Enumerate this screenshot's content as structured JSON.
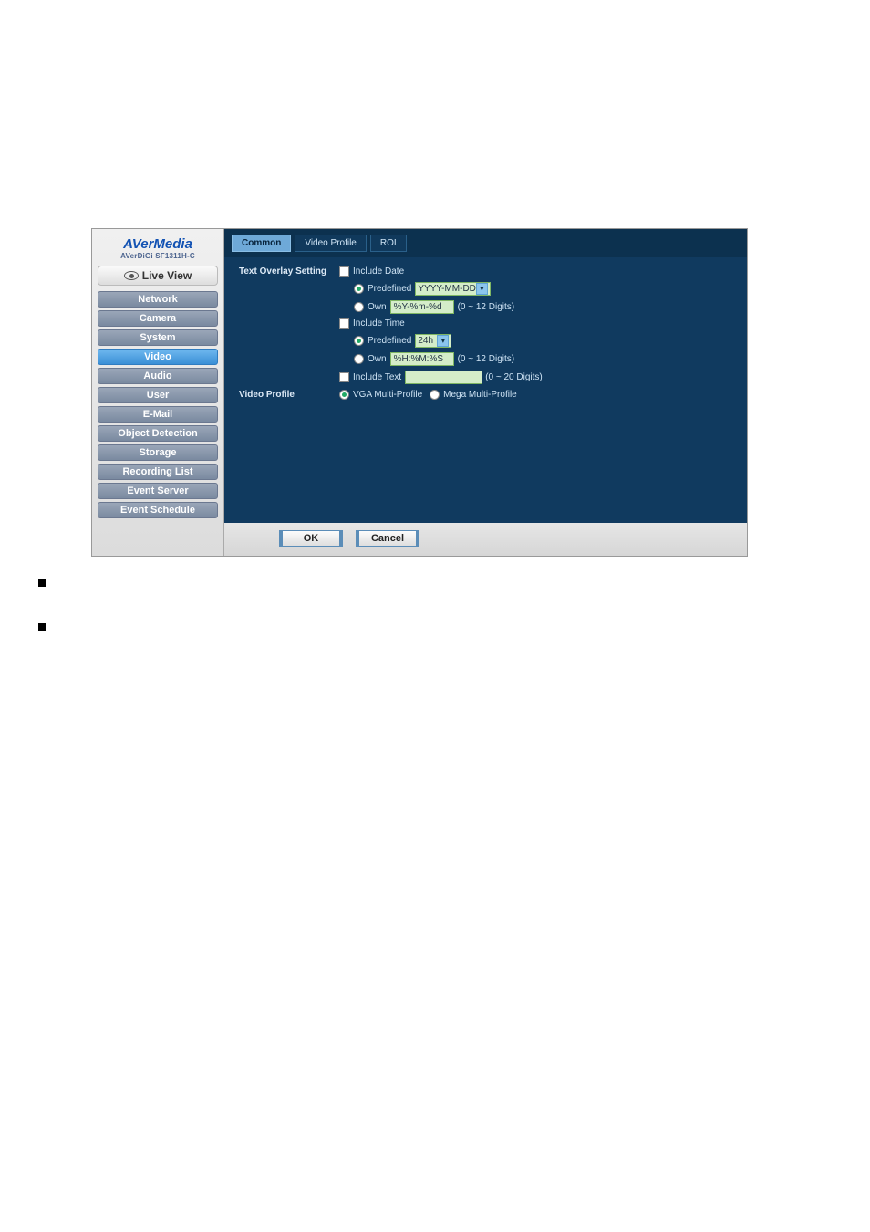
{
  "brand": {
    "logo": "AVerMedia",
    "sub": "AVerDiGi SF1311H-C"
  },
  "live_view": "Live View",
  "nav": [
    {
      "label": "Network",
      "active": false
    },
    {
      "label": "Camera",
      "active": false
    },
    {
      "label": "System",
      "active": false
    },
    {
      "label": "Video",
      "active": true
    },
    {
      "label": "Audio",
      "active": false
    },
    {
      "label": "User",
      "active": false
    },
    {
      "label": "E-Mail",
      "active": false
    },
    {
      "label": "Object Detection",
      "active": false
    },
    {
      "label": "Storage",
      "active": false
    },
    {
      "label": "Recording List",
      "active": false
    },
    {
      "label": "Event Server",
      "active": false
    },
    {
      "label": "Event Schedule",
      "active": false
    }
  ],
  "tabs": [
    {
      "label": "Common",
      "active": true
    },
    {
      "label": "Video Profile",
      "active": false
    },
    {
      "label": "ROI",
      "active": false
    }
  ],
  "sections": {
    "text_overlay": "Text Overlay Setting",
    "video_profile": "Video Profile"
  },
  "overlay": {
    "include_date": "Include Date",
    "date_predefined_label": "Predefined",
    "date_predefined_value": "YYYY-MM-DD",
    "date_own_label": "Own",
    "date_own_value": "%Y-%m-%d",
    "date_own_hint": "(0 ~ 12 Digits)",
    "include_time": "Include Time",
    "time_predefined_label": "Predefined",
    "time_predefined_value": "24h",
    "time_own_label": "Own",
    "time_own_value": "%H:%M:%S",
    "time_own_hint": "(0 ~ 12 Digits)",
    "include_text": "Include Text",
    "include_text_value": "",
    "include_text_hint": "(0 ~ 20 Digits)"
  },
  "profile": {
    "vga": "VGA Multi-Profile",
    "mega": "Mega Multi-Profile"
  },
  "buttons": {
    "ok": "OK",
    "cancel": "Cancel"
  }
}
